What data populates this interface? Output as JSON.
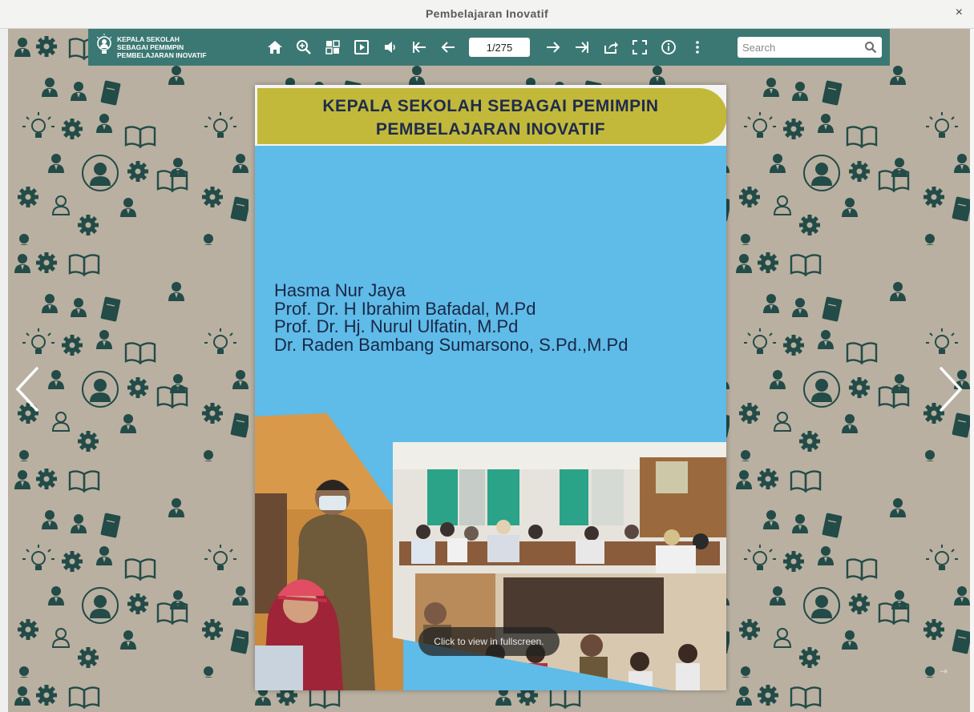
{
  "window": {
    "title": "Pembelajaran Inovatif",
    "close_symbol": "×"
  },
  "toolbar": {
    "logo_lines": [
      "KEPALA SEKOLAH",
      "SEBAGAI PEMIMPIN",
      "PEMBELAJARAN INOVATIF"
    ],
    "page_indicator": "1/275",
    "search_placeholder": "Search",
    "buttons": [
      "home-icon",
      "zoom-in-icon",
      "thumbnails-icon",
      "auto-flip-icon",
      "sound-icon",
      "first-page-icon",
      "previous-page-icon",
      "next-page-icon",
      "last-page-icon",
      "share-icon",
      "fullscreen-icon",
      "info-icon",
      "more-icon"
    ]
  },
  "cover": {
    "title_lines": [
      "KEPALA SEKOLAH SEBAGAI PEMIMPIN",
      "PEMBELAJARAN INOVATIF"
    ],
    "authors": [
      "Hasma Nur Jaya",
      "Prof. Dr. H Ibrahim Bafadal, M.Pd",
      "Prof. Dr. Hj. Nurul Ulfatin, M.Pd",
      "Dr. Raden Bambang Sumarsono, S.Pd.,M.Pd"
    ]
  },
  "overlay": {
    "fullscreen_message": "Click to view in fullscreen."
  },
  "colors": {
    "toolbar": "#3c7873",
    "background": "#b9b0a1",
    "pattern": "#234b47",
    "cover": "#5fbbe8",
    "banner": "#c2b93a"
  }
}
